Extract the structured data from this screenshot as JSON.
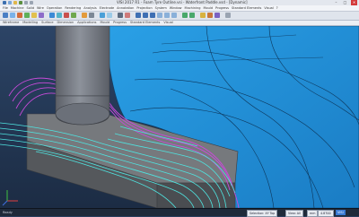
{
  "window": {
    "title": "VISI 2017 R1 - Foam Tyre Outline.vsi - Waterfront Paddle.vsd - [Dynamic]",
    "minimize": "–",
    "maximize": "□",
    "close": "✕"
  },
  "menu": {
    "items": [
      "File",
      "Machine",
      "Solid",
      "Wire",
      "Operation",
      "Rendering",
      "Analysis",
      "Electrode",
      "Annotation",
      "Projection",
      "System",
      "Window",
      "Machining",
      "Mould",
      "Progress",
      "Standard Elements",
      "Visual",
      "?"
    ]
  },
  "tabs2": {
    "items": [
      "Wireframe",
      "Modelling",
      "Surface",
      "Dimension",
      "Applications",
      "Mould",
      "Progress",
      "Standard Elements",
      "Visual"
    ]
  },
  "status": {
    "hint": "Ready",
    "field1": "Selection: XY Top",
    "field2": "View: All",
    "units": "mm",
    "mode": "4.8700",
    "ready": "VISI"
  },
  "colors": {
    "accent": "#3a7bd5",
    "model_blue": "#1f8fd8",
    "toolpath_cyan": "#4fe4e0",
    "toolpath_magenta": "#c84bd9",
    "tool_gray": "#7b808a",
    "block_gray": "#6c6f73"
  }
}
